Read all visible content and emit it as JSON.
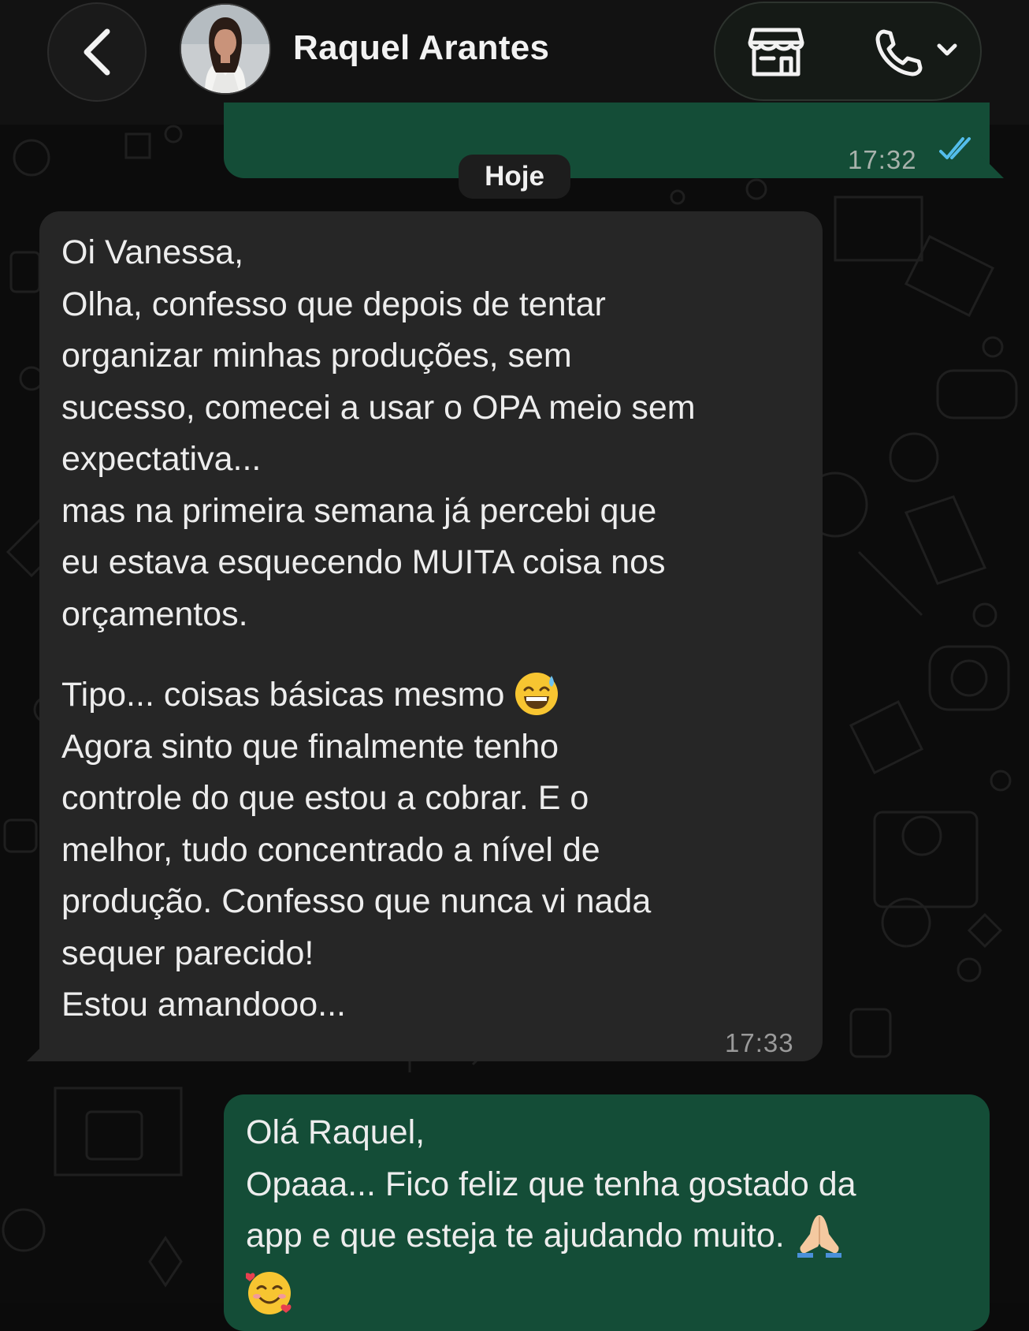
{
  "header": {
    "contact_name": "Raquel Arantes",
    "back_icon": "chevron-left-icon",
    "avatar": "contact-avatar",
    "store_icon": "storefront-icon",
    "call_icon": "phone-icon",
    "call_dropdown_icon": "chevron-down-icon"
  },
  "previous_message": {
    "time": "17:32",
    "status_icon": "double-check-read-icon",
    "status_color": "#53bdeb"
  },
  "date_divider": "Hoje",
  "incoming_message": {
    "lines": [
      "Oi Vanessa,",
      "Olha, confesso que depois de tentar",
      "organizar minhas produções, sem",
      "sucesso, comecei a usar o OPA meio sem",
      "expectativa...",
      "mas na primeira semana já percebi que",
      "eu estava esquecendo MUITA coisa nos",
      "orçamentos.",
      "",
      "Tipo... coisas básicas mesmo",
      "Agora sinto que finalmente tenho",
      "controle do que estou a cobrar. E o",
      "melhor, tudo concentrado a nível de",
      "produção. Confesso que nunca vi nada",
      "sequer parecido!",
      "Estou amandooo..."
    ],
    "emoji": "grinning-sweat-emoji",
    "time": "17:33"
  },
  "outgoing_message": {
    "lines": [
      "Olá Raquel,",
      "Opaaa... Fico feliz que tenha gostado da",
      "app e que esteja te ajudando muito."
    ],
    "emoji_pray": "folded-hands-emoji",
    "emoji_love": "smiling-face-with-hearts-emoji"
  },
  "colors": {
    "outgoing_bubble": "#144d37",
    "incoming_bubble": "#262626",
    "background": "#0c0c0c",
    "header": "#121212"
  }
}
